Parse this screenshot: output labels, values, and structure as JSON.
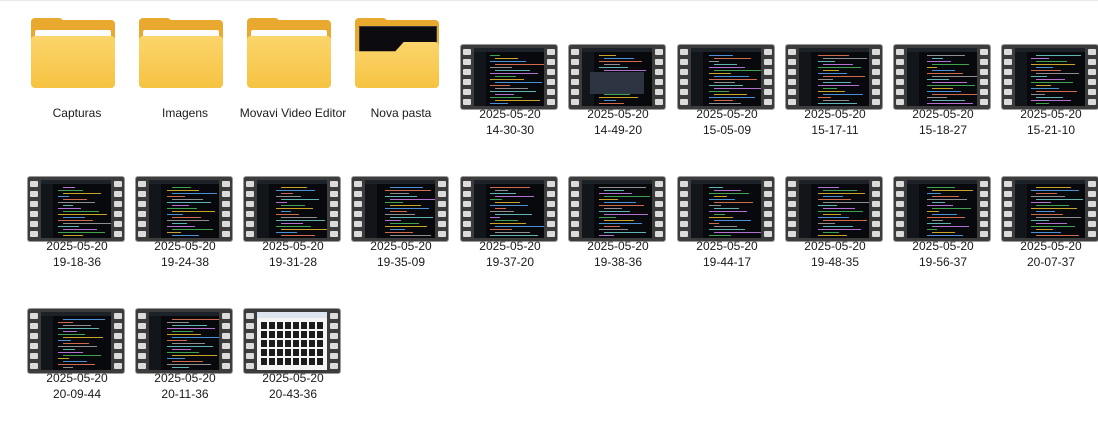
{
  "folders": [
    {
      "name": "Capturas",
      "icon": "folder-icon"
    },
    {
      "name": "Imagens",
      "icon": "folder-icon"
    },
    {
      "name": "Movavi Video Editor",
      "icon": "folder-icon"
    },
    {
      "name": "Nova pasta",
      "icon": "folder-with-preview-icon"
    }
  ],
  "videos": [
    {
      "date": "2025-05-20",
      "time": "14-30-30",
      "preview": "dark-code"
    },
    {
      "date": "2025-05-20",
      "time": "14-49-20",
      "preview": "dark-editor"
    },
    {
      "date": "2025-05-20",
      "time": "15-05-09",
      "preview": "dark-code"
    },
    {
      "date": "2025-05-20",
      "time": "15-17-11",
      "preview": "dark-code"
    },
    {
      "date": "2025-05-20",
      "time": "15-18-27",
      "preview": "dark-code"
    },
    {
      "date": "2025-05-20",
      "time": "15-21-10",
      "preview": "dark-code"
    },
    {
      "date": "2025-05-20",
      "time": "19-18-36",
      "preview": "dark-code"
    },
    {
      "date": "2025-05-20",
      "time": "19-24-38",
      "preview": "dark-code"
    },
    {
      "date": "2025-05-20",
      "time": "19-31-28",
      "preview": "dark-code"
    },
    {
      "date": "2025-05-20",
      "time": "19-35-09",
      "preview": "dark-code"
    },
    {
      "date": "2025-05-20",
      "time": "19-37-20",
      "preview": "dark-code"
    },
    {
      "date": "2025-05-20",
      "time": "19-38-36",
      "preview": "dark-code"
    },
    {
      "date": "2025-05-20",
      "time": "19-44-17",
      "preview": "dark-code"
    },
    {
      "date": "2025-05-20",
      "time": "19-48-35",
      "preview": "dark-code"
    },
    {
      "date": "2025-05-20",
      "time": "19-56-37",
      "preview": "dark-code"
    },
    {
      "date": "2025-05-20",
      "time": "20-07-37",
      "preview": "dark-code"
    },
    {
      "date": "2025-05-20",
      "time": "20-09-44",
      "preview": "dark-code"
    },
    {
      "date": "2025-05-20",
      "time": "20-11-36",
      "preview": "dark-code"
    },
    {
      "date": "2025-05-20",
      "time": "20-43-36",
      "preview": "light-explorer"
    }
  ],
  "colors": {
    "folder_front": "#f6c342",
    "folder_back": "#e8a92e",
    "film_frame": "#3c3c3c",
    "background": "#ffffff"
  }
}
